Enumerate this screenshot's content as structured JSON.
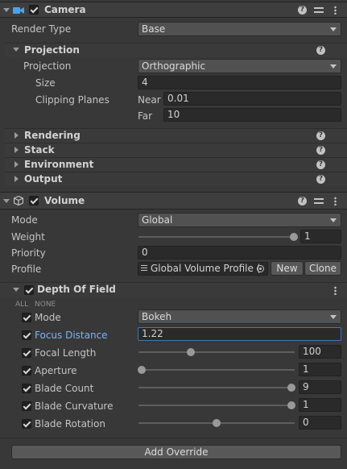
{
  "camera": {
    "title": "Camera",
    "render_type_label": "Render Type",
    "render_type_value": "Base",
    "projection_header": "Projection",
    "projection_label": "Projection",
    "projection_value": "Orthographic",
    "size_label": "Size",
    "size_value": "4",
    "clipping_label": "Clipping Planes",
    "near_label": "Near",
    "near_value": "0.01",
    "far_label": "Far",
    "far_value": "10",
    "sections": [
      "Rendering",
      "Stack",
      "Environment",
      "Output"
    ]
  },
  "volume": {
    "title": "Volume",
    "mode_label": "Mode",
    "mode_value": "Global",
    "weight_label": "Weight",
    "weight_value": "1",
    "priority_label": "Priority",
    "priority_value": "0",
    "profile_label": "Profile",
    "profile_value": "Global Volume Profile (",
    "new_button": "New",
    "clone_button": "Clone"
  },
  "dof": {
    "title": "Depth Of Field",
    "all_label": "ALL",
    "none_label": "NONE",
    "mode_label": "Mode",
    "mode_value": "Bokeh",
    "focus_distance_label": "Focus Distance",
    "focus_distance_value": "1.22",
    "focal_length_label": "Focal Length",
    "focal_length_value": "100",
    "aperture_label": "Aperture",
    "aperture_value": "1",
    "blade_count_label": "Blade Count",
    "blade_count_value": "9",
    "blade_curvature_label": "Blade Curvature",
    "blade_curvature_value": "1",
    "blade_rotation_label": "Blade Rotation",
    "blade_rotation_value": "0"
  },
  "add_override_button": "Add Override",
  "colors": {
    "accent": "#7ab4f5",
    "background": "#383838",
    "header": "#3e3e3e"
  }
}
